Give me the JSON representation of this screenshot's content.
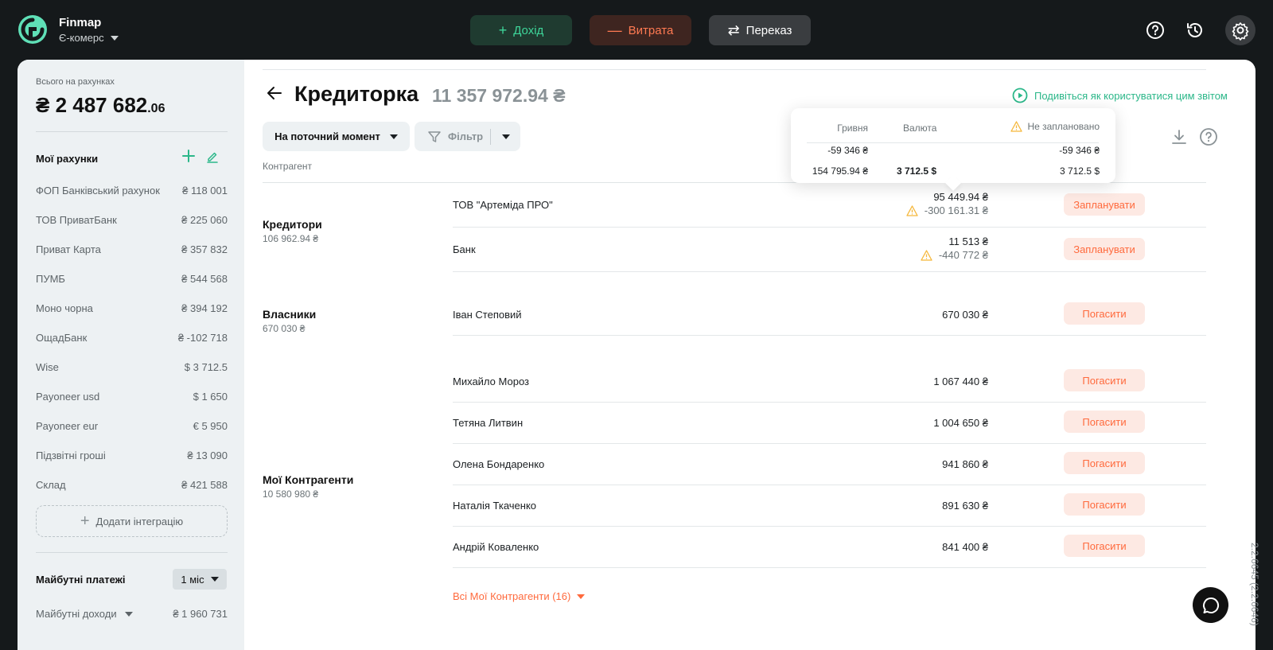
{
  "brand": {
    "name": "Finmap",
    "company": "Є-комерс"
  },
  "top_actions": {
    "income": "Дохід",
    "expense": "Витрата",
    "transfer": "Переказ"
  },
  "sidebar": {
    "total_label": "Всього на рахунках",
    "total_main": "₴ 2 487 682",
    "total_dec": ".06",
    "accounts_title": "Мої рахунки",
    "accounts": [
      {
        "name": "ФОП Банківський рахунок",
        "value": "₴ 118 001"
      },
      {
        "name": "ТОВ ПриватБанк",
        "value": "₴ 225 060"
      },
      {
        "name": "Приват Карта",
        "value": "₴ 357 832"
      },
      {
        "name": "ПУМБ",
        "value": "₴ 544 568"
      },
      {
        "name": "Моно чорна",
        "value": "₴ 394 192"
      },
      {
        "name": "ОщадБанк",
        "value": "₴ -102 718"
      },
      {
        "name": "Wise",
        "value": "$  3 712.5"
      },
      {
        "name": "Payoneer usd",
        "value": "$  1 650"
      },
      {
        "name": "Payoneer eur",
        "value": "€ 5 950"
      },
      {
        "name": "Підзвітні гроші",
        "value": "₴ 13 090"
      },
      {
        "name": "Склад",
        "value": "₴ 421 588"
      }
    ],
    "add_integration": "Додати інтеграцію",
    "future_title": "Майбутні платежі",
    "future_period": "1 міс",
    "future_income_label": "Майбутні доходи",
    "future_income_value": "₴ 1 960 731"
  },
  "page": {
    "title": "Кредиторка",
    "total": "11 357 972.94 ₴",
    "howto": "Подивіться як користуватися цим звітом",
    "period": "На поточний момент",
    "filter": "Фільтр",
    "column_header": "Контрагент"
  },
  "groups": [
    {
      "name": "Кредитори",
      "total": "106 962.94 ₴"
    },
    {
      "name": "Власники",
      "total": "670 030 ₴"
    },
    {
      "name": "Мої Контрагенти",
      "total": "10 580 980 ₴"
    }
  ],
  "rows": [
    {
      "name": "ТОВ \"Артеміда ПРО\"",
      "amount": "95 449.94 ₴",
      "unplanned": "-300 161.31 ₴",
      "action": "Запланувати"
    },
    {
      "name": "Банк",
      "amount": "11 513 ₴",
      "unplanned": "-440 772 ₴",
      "action": "Запланувати"
    },
    {
      "name": "Іван Степовий",
      "amount": "670 030 ₴",
      "action": "Погасити"
    },
    {
      "name": "Михайло Мороз",
      "amount": "1 067 440 ₴",
      "action": "Погасити"
    },
    {
      "name": "Тетяна Литвин",
      "amount": "1 004 650 ₴",
      "action": "Погасити"
    },
    {
      "name": "Олена Бондаренко",
      "amount": "941 860 ₴",
      "action": "Погасити"
    },
    {
      "name": "Наталія Ткаченко",
      "amount": "891 630 ₴",
      "action": "Погасити"
    },
    {
      "name": "Андрій Коваленко",
      "amount": "841 400 ₴",
      "action": "Погасити"
    }
  ],
  "all_link": "Всі Мої Контрагенти (16)",
  "tooltip": {
    "headers": [
      "Гривня",
      "Валюта",
      "Не заплановано"
    ],
    "row1": [
      "-59 346 ₴",
      "",
      "-59 346 ₴"
    ],
    "row2": [
      "154 795.94 ₴",
      "3 712.5  $",
      "3 712.5  $"
    ]
  },
  "version": "2.2.6645 (2.2.6646)",
  "colors": {
    "accent_green": "#2bb789",
    "accent_orange": "#ff6a3d",
    "dark_bg": "#15191b"
  }
}
